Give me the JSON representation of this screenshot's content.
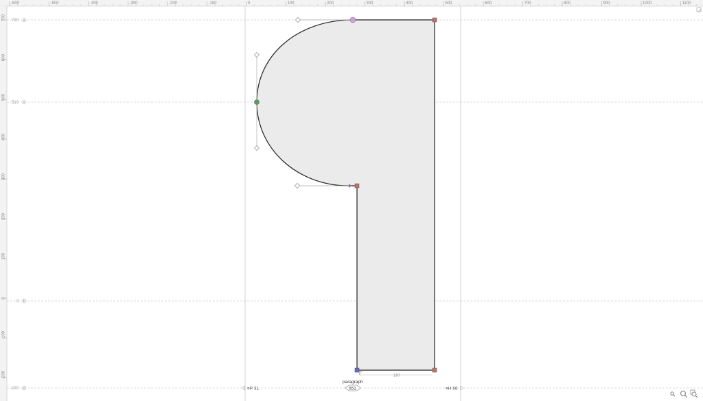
{
  "ruler": {
    "x_ticks": [
      "-600",
      "-500",
      "-400",
      "-300",
      "-200",
      "-100",
      "0",
      "100",
      "200",
      "300",
      "400",
      "500",
      "600",
      "700",
      "800",
      "900",
      "1000",
      "1100"
    ],
    "y_ticks": [
      "700",
      "600",
      "500",
      "400",
      "300",
      "200",
      "100",
      "0",
      "-100",
      "-200"
    ]
  },
  "metrics": {
    "ascender": {
      "value": "720",
      "badge": "a"
    },
    "xheight": {
      "value": "510",
      "badge": "x"
    },
    "baseline": {
      "value": "0",
      "badge": "b"
    },
    "descender": {
      "value": "-220",
      "badge": "d"
    }
  },
  "measure_label": "197",
  "glyph": {
    "name": "paragraph",
    "width": "551",
    "lsb_label": "≡P 31",
    "rsb_label": "≡H 66"
  },
  "icons": {
    "zoom_out": "zoom-out-icon",
    "zoom_in": "zoom-in-icon",
    "zoom_fit": "zoom-fit-icon",
    "corner": "corner-fold-icon"
  },
  "colors": {
    "fill": "#ebebeb",
    "outline": "#222222",
    "node_corner": "#b77470",
    "node_smooth": "#5f9a63",
    "node_start": "#6a6bb5",
    "node_handle_sel": "#c9a3d1"
  }
}
